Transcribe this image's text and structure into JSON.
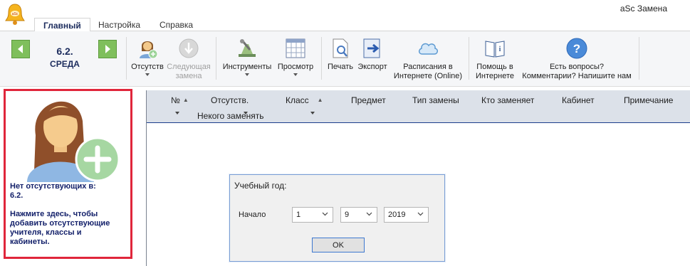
{
  "window": {
    "title": "aSc Замена",
    "icon": "bell-icon"
  },
  "tabs": [
    {
      "label": "Главный",
      "active": true
    },
    {
      "label": "Настройка",
      "active": false
    },
    {
      "label": "Справка",
      "active": false
    }
  ],
  "ribbon": {
    "date_number": "6.2.",
    "date_day": "СРЕДА",
    "buttons": {
      "absences": "Отсутств",
      "next_sub_line1": "Следующая",
      "next_sub_line2": "замена",
      "tools": "Инструменты",
      "view": "Просмотр",
      "print": "Печать",
      "export": "Экспорт",
      "online_line1": "Расписания в",
      "online_line2": "Интернете (Online)",
      "help_line1": "Помощь в",
      "help_line2": "Интернете",
      "questions_line1": "Есть вопросы?",
      "questions_line2": "Комментарии? Напишите нам"
    },
    "colors": {
      "nav_green": "#7fbf5c",
      "accent_blue": "#1d2d5e"
    }
  },
  "left_panel": {
    "line1": "Нет отсутствующих в:",
    "line2": "6.2.",
    "line3": "Нажмите здесь, чтобы",
    "line4": "добавить отсутствующие",
    "line5": "учителя, классы и",
    "line6": "кабинеты.",
    "border_color": "#e0263b"
  },
  "grid": {
    "columns": {
      "num": "№",
      "absent": "Отсутств.",
      "class": "Класс",
      "subject": "Предмет",
      "type": "Тип замены",
      "who": "Кто заменяет",
      "room": "Кабинет",
      "note": "Примечание"
    },
    "sub_header": "Некого заменять"
  },
  "dialog": {
    "title": "Учебный год:",
    "start_label": "Начало",
    "day": "1",
    "month": "9",
    "year": "2019",
    "ok_label": "OK"
  }
}
